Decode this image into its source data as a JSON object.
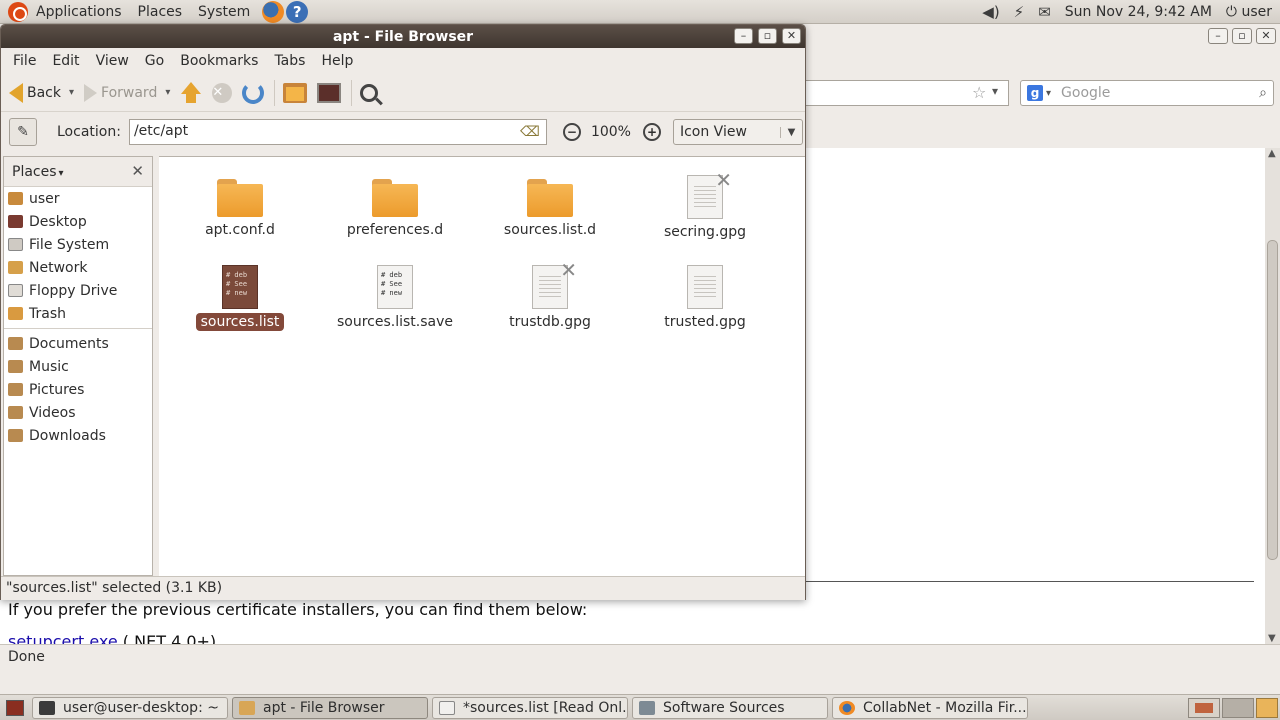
{
  "top_panel": {
    "menus": [
      "Applications",
      "Places",
      "System"
    ],
    "datetime": "Sun Nov 24,  9:42 AM",
    "user": "user",
    "icons": [
      "ubuntu-logo",
      "firefox-icon",
      "help-icon",
      "volume-icon",
      "network-icon",
      "mail-icon",
      "power-icon"
    ]
  },
  "firefox": {
    "search_placeholder": "Google",
    "text_line": "If you prefer the previous certificate installers, you can find them below:",
    "link_text": "setupcert.exe",
    "link_after": " (.NET 4.0+)",
    "status": "Done"
  },
  "file_browser": {
    "title": "apt - File Browser",
    "menu": [
      "File",
      "Edit",
      "View",
      "Go",
      "Bookmarks",
      "Tabs",
      "Help"
    ],
    "toolbar": {
      "back": "Back",
      "forward": "Forward"
    },
    "location_label": "Location:",
    "location_value": "/etc/apt",
    "zoom": "100%",
    "view_mode": "Icon View",
    "sidebar_header": "Places",
    "places": [
      {
        "label": "user",
        "icon": "home-icon"
      },
      {
        "label": "Desktop",
        "icon": "desktop-icon"
      },
      {
        "label": "File System",
        "icon": "filesystem-icon"
      },
      {
        "label": "Network",
        "icon": "network-icon"
      },
      {
        "label": "Floppy Drive",
        "icon": "floppy-icon"
      },
      {
        "label": "Trash",
        "icon": "trash-icon"
      }
    ],
    "bookmarks": [
      {
        "label": "Documents",
        "icon": "folder-icon"
      },
      {
        "label": "Music",
        "icon": "folder-icon"
      },
      {
        "label": "Pictures",
        "icon": "folder-icon"
      },
      {
        "label": "Videos",
        "icon": "folder-icon"
      },
      {
        "label": "Downloads",
        "icon": "folder-icon"
      }
    ],
    "files": [
      {
        "name": "apt.conf.d",
        "type": "folder"
      },
      {
        "name": "preferences.d",
        "type": "folder"
      },
      {
        "name": "sources.list.d",
        "type": "folder"
      },
      {
        "name": "secring.gpg",
        "type": "file-unreadable"
      },
      {
        "name": "sources.list",
        "type": "text-selected",
        "preview": [
          "# deb",
          "# See",
          "# new"
        ]
      },
      {
        "name": "sources.list.save",
        "type": "text",
        "preview": [
          "# deb",
          "# See",
          "# new"
        ]
      },
      {
        "name": "trustdb.gpg",
        "type": "file-unreadable"
      },
      {
        "name": "trusted.gpg",
        "type": "file"
      }
    ],
    "status": "\"sources.list\" selected (3.1 KB)"
  },
  "taskbar": {
    "tasks": [
      {
        "label": "user@user-desktop: ~",
        "icon": "terminal-icon"
      },
      {
        "label": "apt - File Browser",
        "icon": "file-browser-icon",
        "active": true
      },
      {
        "label": "*sources.list [Read Onl...",
        "icon": "text-editor-icon"
      },
      {
        "label": "Software Sources",
        "icon": "software-sources-icon"
      },
      {
        "label": "CollabNet - Mozilla Fir...",
        "icon": "firefox-icon"
      }
    ]
  },
  "colors": {
    "title_bar": "#4a3f38",
    "selection": "#83493a",
    "folder": "#f0a53a",
    "link": "#1a0dab"
  }
}
